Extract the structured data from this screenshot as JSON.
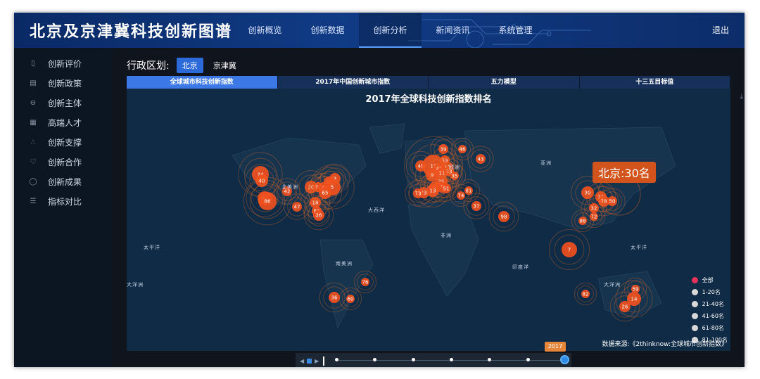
{
  "app": {
    "title": "北京及京津冀科技创新图谱"
  },
  "nav": {
    "items": [
      {
        "label": "创新概览"
      },
      {
        "label": "创新数据"
      },
      {
        "label": "创新分析",
        "active": true
      },
      {
        "label": "新闻资讯"
      },
      {
        "label": "系统管理"
      }
    ],
    "logout": "退出"
  },
  "sidebar": {
    "items": [
      {
        "label": "创新评价",
        "icon": "document-icon"
      },
      {
        "label": "创新政策",
        "icon": "policy-icon"
      },
      {
        "label": "创新主体",
        "icon": "entity-icon"
      },
      {
        "label": "高端人才",
        "icon": "talent-icon"
      },
      {
        "label": "创新支撑",
        "icon": "support-icon"
      },
      {
        "label": "创新合作",
        "icon": "handshake-icon"
      },
      {
        "label": "创新成果",
        "icon": "award-icon"
      },
      {
        "label": "指标对比",
        "icon": "database-icon"
      }
    ]
  },
  "region": {
    "label": "行政区划:",
    "options": [
      {
        "label": "北京",
        "active": true
      },
      {
        "label": "京津冀"
      }
    ]
  },
  "tabs": [
    {
      "label": "全球城市科技创新指数",
      "active": true
    },
    {
      "label": "2017年中国创新城市指数"
    },
    {
      "label": "五力模型"
    },
    {
      "label": "十三五目标值"
    }
  ],
  "map": {
    "title": "2017年全球科技创新指数排名",
    "tooltip": "北京:30名",
    "source": "数据来源:《2thinknow:全球城市创新指数》",
    "colors": {
      "ocean": "#0f2b45",
      "land": "#16324d",
      "bubble": "#f0501e",
      "halo": "#e06a28"
    },
    "region_names": [
      "北美洲",
      "欧洲",
      "亚洲",
      "大西洋",
      "非洲",
      "南美洲",
      "印度洋",
      "大洋洲",
      "太平洋",
      "太平洋",
      "大洋洲"
    ],
    "legend": [
      {
        "label": "全部",
        "color": "#e8315a"
      },
      {
        "label": "1-20名",
        "color": "#d9d9d9"
      },
      {
        "label": "21-40名",
        "color": "#d9d9d9"
      },
      {
        "label": "41-60名",
        "color": "#d9d9d9"
      },
      {
        "label": "61-80名",
        "color": "#d9d9d9"
      },
      {
        "label": "81-100名",
        "color": "#d9d9d9"
      }
    ],
    "markers": [
      "24",
      "40",
      "99",
      "86",
      "42",
      "20",
      "77",
      "8",
      "19",
      "3",
      "5",
      "65",
      "18",
      "47",
      "85",
      "26",
      "39",
      "46",
      "33",
      "43",
      "49",
      "12",
      "41",
      "17",
      "53",
      "11",
      "9",
      "25",
      "4",
      "1",
      "35",
      "23",
      "13",
      "51",
      "73",
      "81",
      "74",
      "37",
      "98",
      "30",
      "11",
      "78",
      "50",
      "32",
      "72",
      "88",
      "7",
      "36",
      "60",
      "76",
      "82",
      "59",
      "14",
      "26"
    ]
  },
  "timeline": {
    "current_year": "2017",
    "current_index": 6,
    "count": 7
  }
}
